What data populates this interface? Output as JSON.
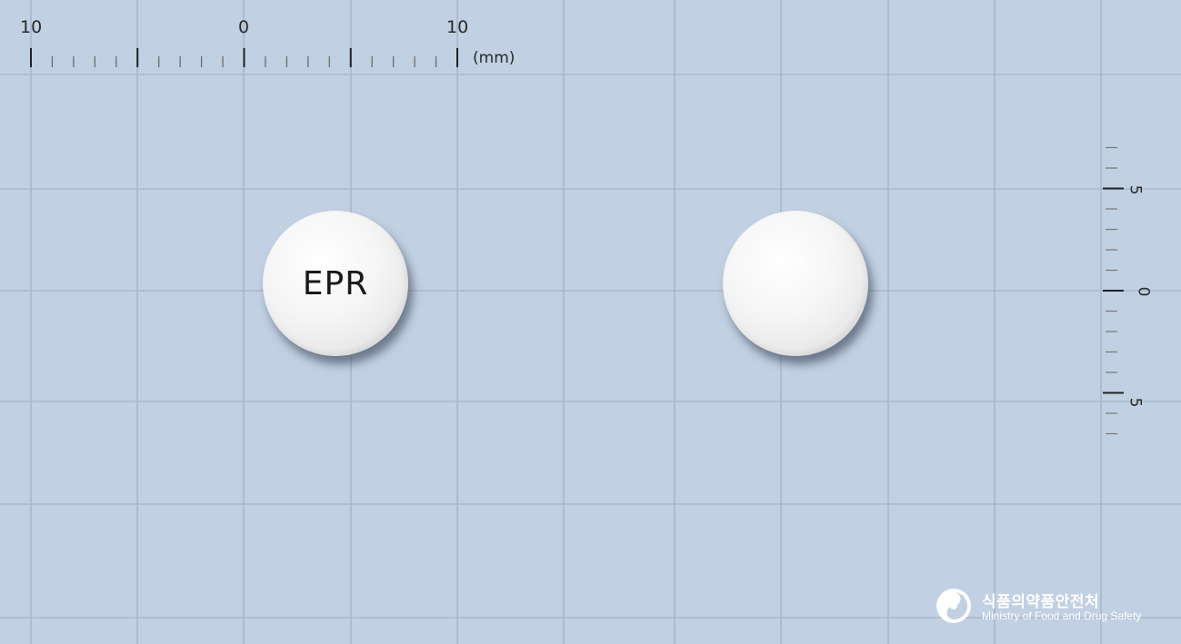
{
  "ruler_horizontal": {
    "labels": [
      "10",
      "0",
      "10"
    ],
    "unit": "(mm)"
  },
  "ruler_vertical": {
    "labels": [
      "5",
      "0",
      "5"
    ]
  },
  "pills": [
    {
      "side": "front",
      "imprint": "EPR",
      "color": "#ffffff",
      "shape": "round"
    },
    {
      "side": "back",
      "imprint": "",
      "color": "#ffffff",
      "shape": "round"
    }
  ],
  "logo": {
    "korean": "식품의약품안전처",
    "english": "Ministry of Food and Drug Safety"
  },
  "colors": {
    "background": "#c1d0e2",
    "grid": "#a9b8cc"
  }
}
